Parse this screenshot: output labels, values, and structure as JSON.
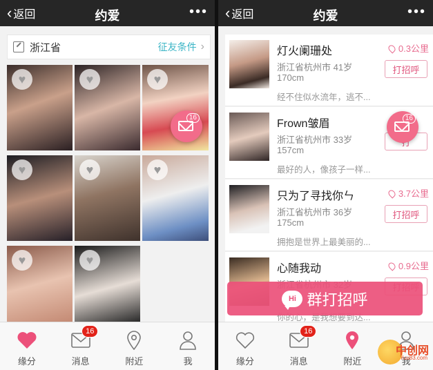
{
  "left": {
    "topbar": {
      "back_label": "返回",
      "title": "约爱",
      "more": "•••"
    },
    "filter": {
      "province": "浙江省",
      "condition_label": "征友条件",
      "arrow": "›"
    },
    "floating_mail": {
      "count": "16"
    },
    "tabs": [
      {
        "label": "缘分",
        "active": true
      },
      {
        "label": "消息",
        "badge": "16"
      },
      {
        "label": "附近"
      },
      {
        "label": "我"
      }
    ]
  },
  "right": {
    "topbar": {
      "back_label": "返回",
      "title": "约爱",
      "more": "•••"
    },
    "users": [
      {
        "name": "灯火阑珊处",
        "distance": "0.3公里",
        "location": "浙江省杭州市 41岁",
        "height": "170cm",
        "bio": "经不住似水流年，逃不...",
        "greet": "打招呼"
      },
      {
        "name": "Frown皱眉",
        "distance": "",
        "location": "浙江省杭州市 33岁",
        "height": "157cm",
        "bio": "最好的人，像孩子一样...",
        "greet": "打"
      },
      {
        "name": "只为了寻找你ㄣ",
        "distance": "3.7公里",
        "location": "浙江省杭州市 36岁",
        "height": "175cm",
        "bio": "拥抱是世界上最美丽的...",
        "greet": "打招呼"
      },
      {
        "name": "心随我动",
        "distance": "0.9公里",
        "location": "浙江省杭州市 32岁",
        "height": "",
        "bio": "你的心，是我想要到达...",
        "greet": "打招呼"
      }
    ],
    "floating_mail": {
      "count": "16"
    },
    "mass_greet": {
      "bubble": "Hi",
      "label": "群打招呼"
    },
    "tabs": [
      {
        "label": "缘分"
      },
      {
        "label": "消息",
        "badge": "16"
      },
      {
        "label": "附近",
        "active": true
      },
      {
        "label": "我"
      }
    ],
    "watermark": {
      "text": "中创网",
      "sub": "Yuu83.com"
    }
  },
  "colors": {
    "accent_pink": "#ec507a",
    "teal": "#3cb5c6",
    "topbar": "#262626"
  }
}
